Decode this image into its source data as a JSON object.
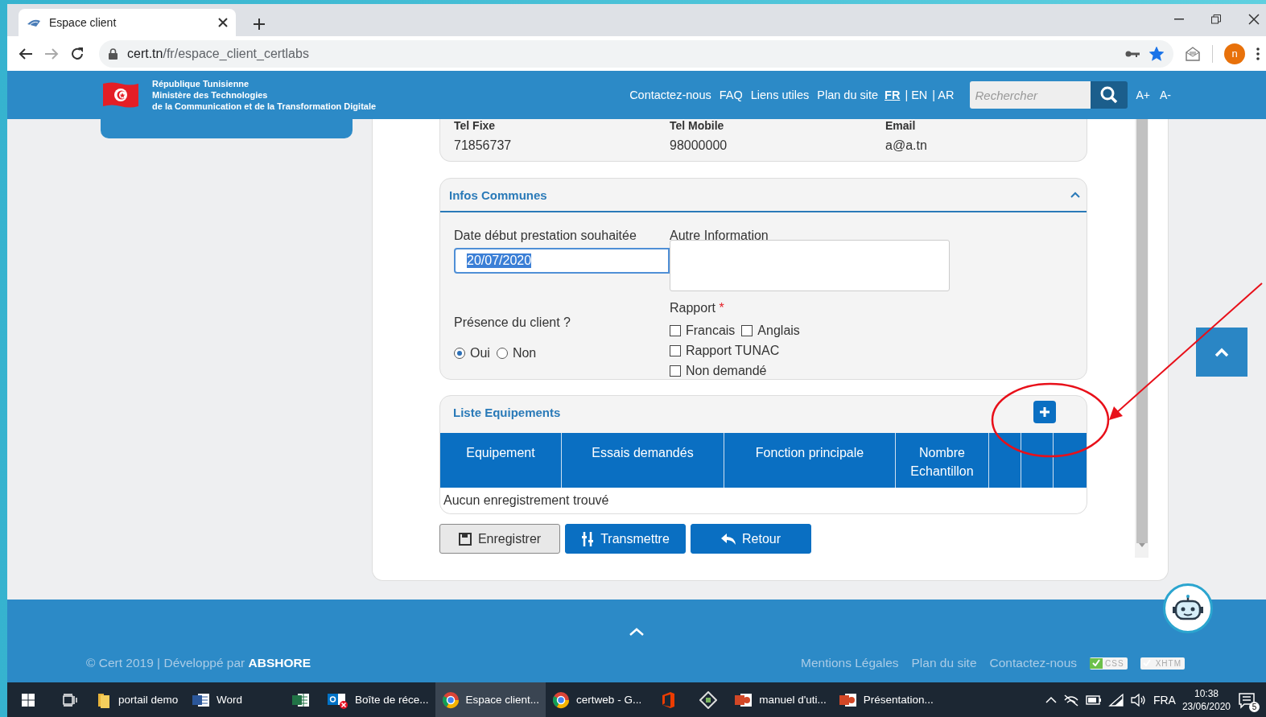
{
  "browser": {
    "tab": {
      "title": "Espace client"
    },
    "url": {
      "host": "cert.tn",
      "path": "/fr/espace_client_certlabs"
    },
    "bookmarked": true,
    "profile_initial": "n"
  },
  "header": {
    "org_lines": [
      "République Tunisienne",
      "Ministère des Technologies",
      "de la Communication et de la Transformation Digitale"
    ],
    "nav": [
      "Contactez-nous",
      "FAQ",
      "Liens utiles",
      "Plan du site"
    ],
    "languages": [
      {
        "label": "FR",
        "selected": true
      },
      {
        "label": "| EN",
        "selected": false
      },
      {
        "label": "| AR",
        "selected": false
      }
    ],
    "search": {
      "placeholder": "Rechercher"
    },
    "font_buttons": [
      "A+",
      "A-"
    ]
  },
  "contact": {
    "fields": [
      {
        "label": "Tel Fixe",
        "value": "71856737"
      },
      {
        "label": "Tel Mobile",
        "value": "98000000"
      },
      {
        "label": "Email",
        "value": "a@a.tn"
      }
    ]
  },
  "infos_communes": {
    "title": "Infos Communes",
    "expanded": true,
    "date_label": "Date début prestation souhaitée",
    "date_value": "20/07/2020",
    "other_label": "Autre Information",
    "presence_label": "Présence du client ?",
    "presence_options": [
      {
        "label": "Oui",
        "selected": true
      },
      {
        "label": "Non",
        "selected": false
      }
    ],
    "report_label": "Rapport",
    "required_mark": "*",
    "report_options": [
      {
        "label": "Francais",
        "checked": false
      },
      {
        "label": "Anglais",
        "checked": false
      },
      {
        "label": "Rapport TUNAC",
        "checked": false
      },
      {
        "label": "Non demandé",
        "checked": false
      }
    ]
  },
  "equipements": {
    "title": "Liste Equipements",
    "columns": [
      "Equipement",
      "Essais demandés",
      "Fonction principale",
      "Nombre Echantillon"
    ],
    "empty_message": "Aucun enregistrement trouvé"
  },
  "actions": [
    {
      "kind": "save",
      "label": "Enregistrer"
    },
    {
      "kind": "transmit",
      "label": "Transmettre"
    },
    {
      "kind": "back",
      "label": "Retour"
    }
  ],
  "footer": {
    "copyright": "© Cert 2019 | Développé par",
    "developer": "ABSHORE",
    "links": [
      "Mentions Légales",
      "Plan du site",
      "Contactez-nous"
    ],
    "badges": [
      "CSS",
      "XHTM"
    ]
  },
  "taskbar": {
    "items": [
      {
        "kind": "folder",
        "label": "portail demo",
        "selected": false
      },
      {
        "kind": "word",
        "label": "Word",
        "selected": false
      },
      {
        "kind": "excel",
        "selected": false
      },
      {
        "kind": "outlook",
        "label": "Boîte de réce...",
        "selected": false
      },
      {
        "kind": "chrome",
        "label": "Espace client...",
        "selected": true
      },
      {
        "kind": "chrome",
        "label": "certweb - G...",
        "selected": false
      },
      {
        "kind": "office",
        "selected": false
      },
      {
        "kind": "app",
        "selected": false
      },
      {
        "kind": "powerpoint",
        "label": "manuel d'uti...",
        "selected": false
      },
      {
        "kind": "powerpoint",
        "label": "Présentation...",
        "selected": false
      }
    ],
    "language": "FRA",
    "time": "10:38",
    "date": "23/06/2020",
    "notification_count": "5"
  }
}
